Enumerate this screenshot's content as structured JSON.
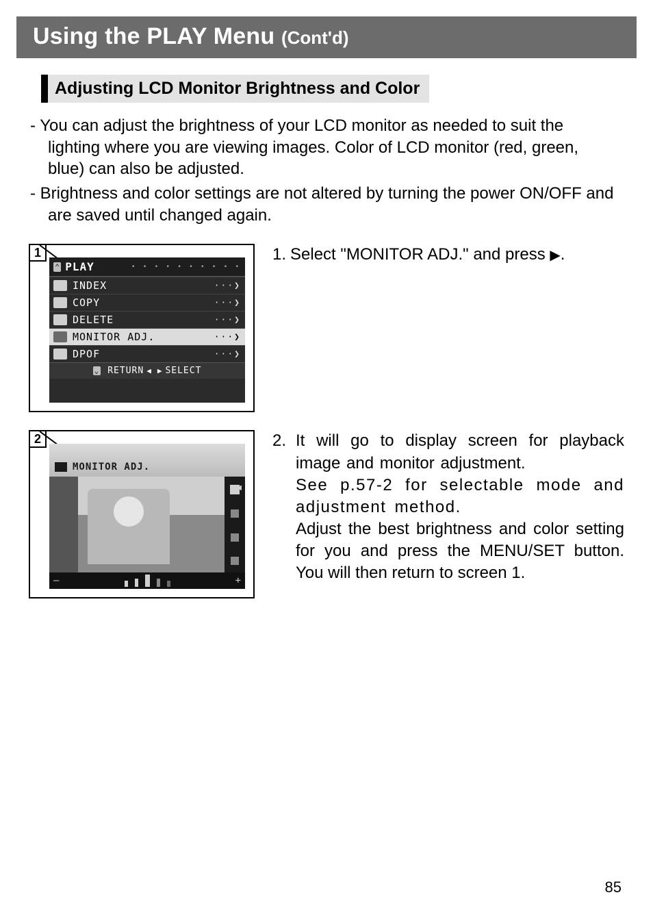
{
  "header": {
    "title_main": "Using the PLAY Menu ",
    "title_sub": "(Cont'd)"
  },
  "subheading": "Adjusting LCD Monitor Brightness and Color",
  "intro": {
    "p1": "- You can adjust the brightness of your LCD monitor as needed to suit the lighting where you are viewing images. Color of LCD monitor (red, green, blue) can also be adjusted.",
    "p2": "- Brightness and color settings are not altered by turning the power ON/OFF and are saved until changed again."
  },
  "figure1": {
    "number": "1",
    "menu_title": "PLAY",
    "items": [
      {
        "label": "INDEX"
      },
      {
        "label": "COPY"
      },
      {
        "label": "DELETE"
      },
      {
        "label": "MONITOR ADJ.",
        "selected": true
      },
      {
        "label": "DPOF"
      }
    ],
    "footer_return": "RETURN",
    "footer_select": "SELECT"
  },
  "step1": {
    "num": "1.",
    "text": "Select \"MONITOR ADJ.\" and press ",
    "glyph": "▶",
    "tail": "."
  },
  "figure2": {
    "number": "2",
    "label": "MONITOR ADJ.",
    "minus": "–",
    "plus": "+"
  },
  "step2": {
    "num": "2.",
    "line1": "It will go to display screen for playback image and monitor adjustment.",
    "line2": "See p.57-2 for selectable mode and adjustment method.",
    "line3": "Adjust the best brightness and color setting for you and press the MENU/SET button. You will then return to screen 1."
  },
  "page_number": "85"
}
